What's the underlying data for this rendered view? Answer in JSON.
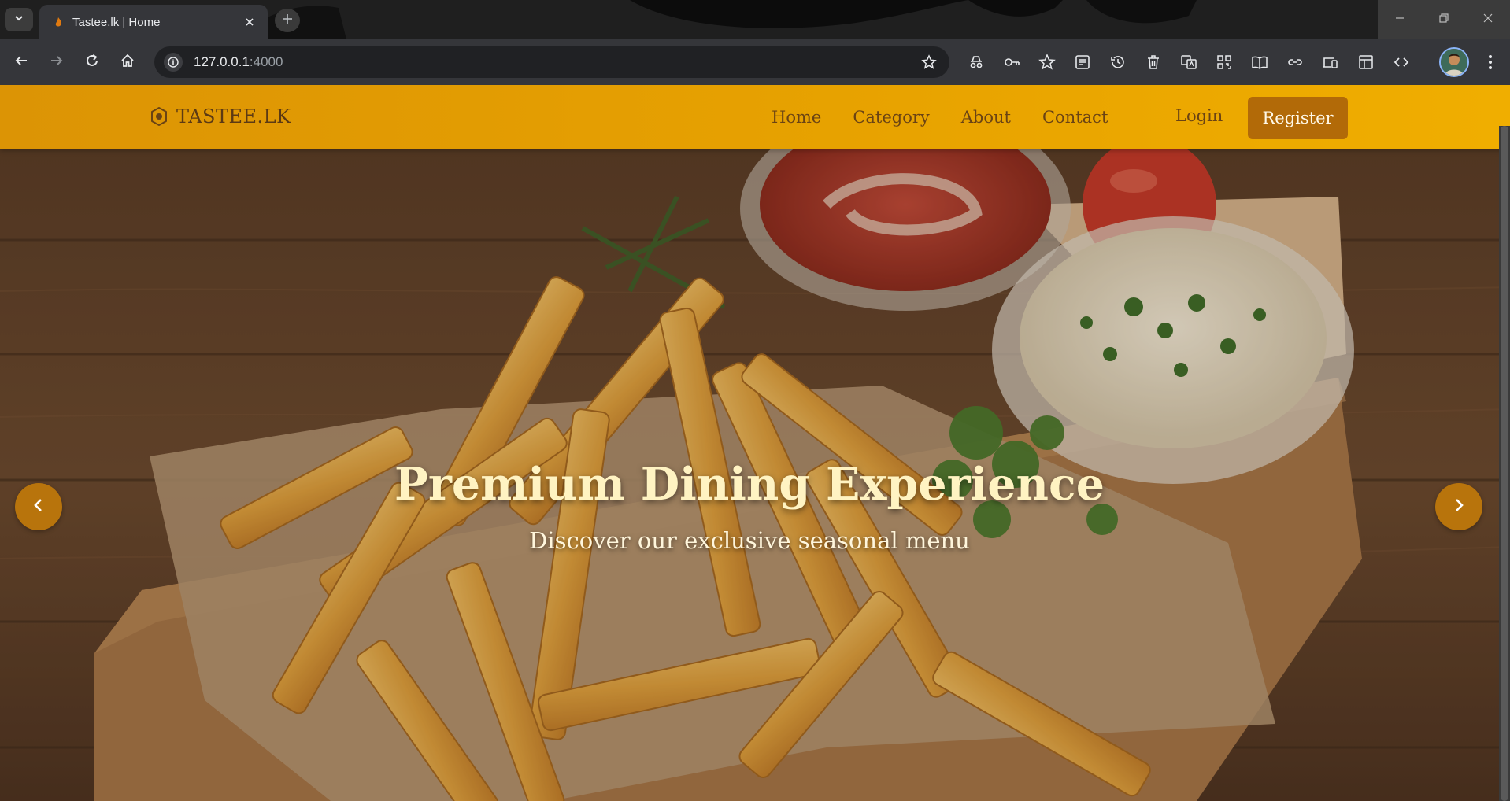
{
  "browser": {
    "tab": {
      "title": "Tastee.lk | Home",
      "favicon": "flame-favicon"
    },
    "url": {
      "host": "127.0.0.1",
      "port": ":4000"
    },
    "icons": {
      "tab_list": "chevron-down-icon",
      "tab_close": "close-icon",
      "new_tab": "plus-icon",
      "back": "arrow-left-icon",
      "forward": "arrow-right-icon",
      "reload": "reload-icon",
      "home": "home-icon",
      "site_info": "info-icon",
      "bookmark": "star-icon",
      "extensions": [
        "incognito-icon",
        "key-icon",
        "star-plus-icon",
        "reading-list-icon",
        "history-icon",
        "delete-icon",
        "translate-icon",
        "qr-code-icon",
        "reader-mode-icon",
        "link-icon",
        "devices-icon",
        "side-panel-icon",
        "code-icon"
      ],
      "menu": "more-vert-icon"
    }
  },
  "site": {
    "brand": "TASTEE.LK",
    "nav": {
      "home": "Home",
      "category": "Category",
      "about": "About",
      "contact": "Contact",
      "login": "Login",
      "register": "Register"
    },
    "hero": {
      "title": "Premium Dining Experience",
      "subtitle": "Discover our exclusive seasonal menu",
      "prev_icon": "chevron-left-icon",
      "next_icon": "chevron-right-icon"
    }
  },
  "colors": {
    "navbar": "#e8a300",
    "register_button": "#b26a08",
    "nav_text": "#6a4314",
    "hero_title": "#fff3c2",
    "carousel_button": "#b8740c"
  }
}
